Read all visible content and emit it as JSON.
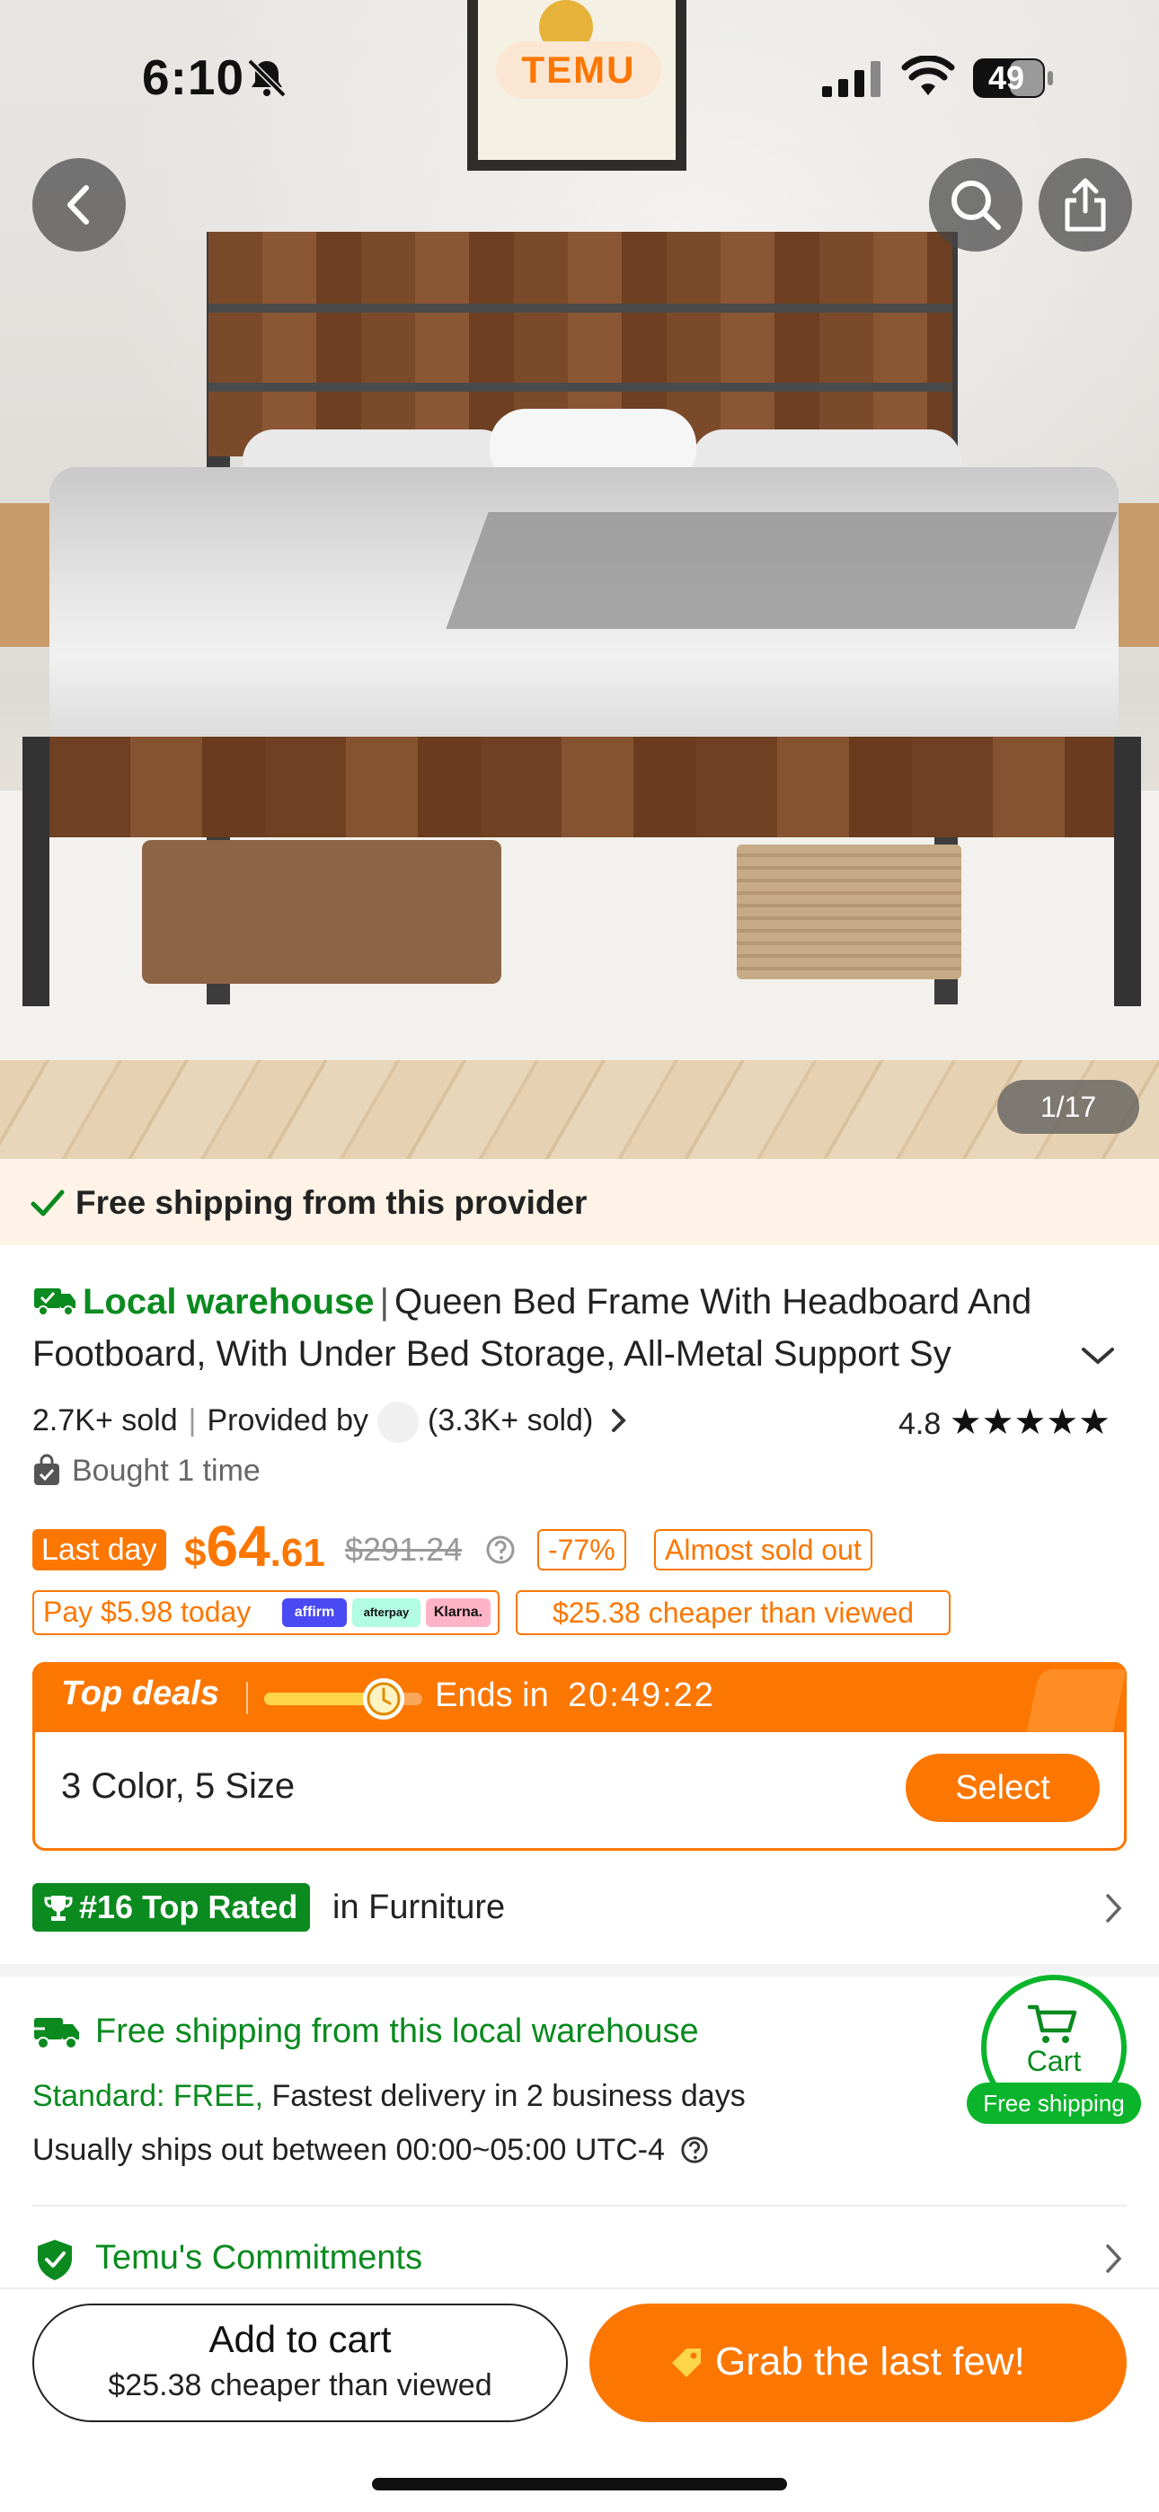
{
  "status_bar": {
    "time": "6:10",
    "battery": "49"
  },
  "header": {
    "logo": "TEMU"
  },
  "hero": {
    "counter": "1/17"
  },
  "banner": {
    "text": "Free shipping from this provider"
  },
  "product": {
    "warehouse_label": "Local warehouse",
    "title": "Queen Bed Frame With Headboard And Footboard, With Under Bed Storage, All-Metal Support Sy",
    "sold": "2.7K+ sold",
    "provided_by": "Provided by",
    "store_sold": "(3.3K+ sold)",
    "rating": "4.8",
    "stars": "★★★★★",
    "bought": "Bought 1 time"
  },
  "pricing": {
    "badge": "Last day",
    "currency": "$",
    "price_whole": "64",
    "price_cents": ".61",
    "original_price": "$291.24",
    "discount": "-77%",
    "stock_tag": "Almost sold out",
    "pay_today": "Pay $5.98 today",
    "paylater_logos": [
      "affirm",
      "afterpay",
      "Klarna."
    ],
    "cheaper_tag": "$25.38 cheaper than viewed"
  },
  "deals": {
    "title": "Top deals",
    "progress": 0.74,
    "ends_label": "Ends in",
    "countdown": "20:49:22",
    "variants": "3 Color, 5 Size",
    "select_label": "Select"
  },
  "ranking": {
    "badge": "#16 Top Rated",
    "category": "in Furniture"
  },
  "shipping": {
    "title": "Free shipping from this local warehouse",
    "standard": "Standard: FREE,",
    "fastest": "Fastest delivery in 2 business days",
    "ships_out": "Usually ships out between 00:00~05:00 UTC-4"
  },
  "cart_widget": {
    "label": "Cart",
    "pill": "Free shipping"
  },
  "commitments": {
    "label": "Temu's Commitments"
  },
  "bottom": {
    "add_label": "Add to cart",
    "add_sub": "$25.38 cheaper than viewed",
    "grab_label": "Grab the last few!"
  },
  "colors": {
    "accent": "#fb7701",
    "green": "#0a8a1f"
  }
}
